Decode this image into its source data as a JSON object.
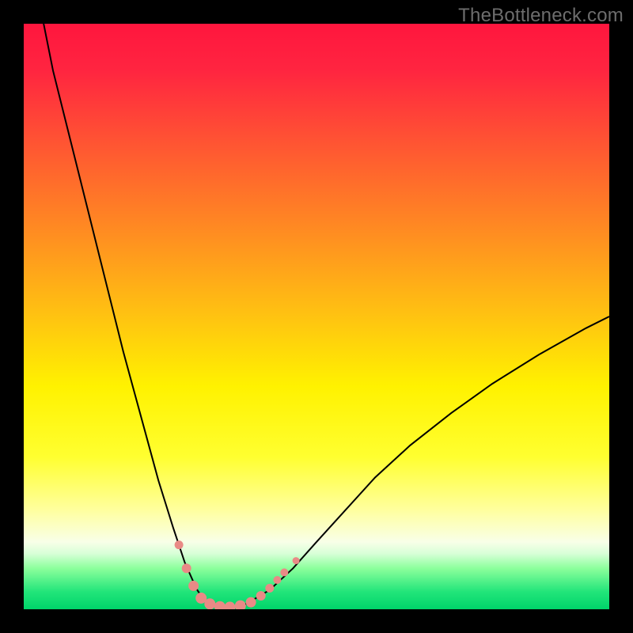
{
  "watermark": {
    "text": "TheBottleneck.com"
  },
  "chart_data": {
    "type": "line",
    "title": "",
    "xlabel": "",
    "ylabel": "",
    "xlim": [
      0,
      100
    ],
    "ylim": [
      0,
      100
    ],
    "background": {
      "gradient_stops": [
        {
          "offset": 0.0,
          "color": "#ff163e"
        },
        {
          "offset": 0.08,
          "color": "#ff2540"
        },
        {
          "offset": 0.2,
          "color": "#ff5333"
        },
        {
          "offset": 0.35,
          "color": "#ff8a22"
        },
        {
          "offset": 0.5,
          "color": "#ffc311"
        },
        {
          "offset": 0.62,
          "color": "#fff200"
        },
        {
          "offset": 0.74,
          "color": "#ffff30"
        },
        {
          "offset": 0.83,
          "color": "#ffff9e"
        },
        {
          "offset": 0.885,
          "color": "#f8ffe8"
        },
        {
          "offset": 0.905,
          "color": "#d7ffd7"
        },
        {
          "offset": 0.93,
          "color": "#8cff9c"
        },
        {
          "offset": 0.97,
          "color": "#22e57a"
        },
        {
          "offset": 1.0,
          "color": "#00d46a"
        }
      ]
    },
    "series": [
      {
        "name": "bottleneck-curve",
        "color": "#000000",
        "stroke_width": 2,
        "x": [
          3,
          5,
          8,
          11,
          14,
          17,
          20,
          23,
          25.5,
          27.5,
          29.5,
          31,
          33,
          35,
          38,
          42,
          46,
          50,
          55,
          60,
          66,
          73,
          80,
          88,
          96,
          100
        ],
        "y": [
          102,
          92,
          80,
          68,
          56,
          44,
          33,
          22,
          14,
          8,
          3.5,
          1.2,
          0.4,
          0.3,
          0.9,
          3.3,
          7,
          11.5,
          17,
          22.5,
          28,
          33.5,
          38.5,
          43.5,
          48,
          50
        ]
      }
    ],
    "markers": [
      {
        "name": "highlight-dots",
        "color": "#e98a86",
        "radius_sequence": [
          5.5,
          6,
          6.5,
          7,
          7,
          7,
          7,
          7,
          6.5,
          6,
          5.5,
          5,
          5,
          4.5
        ],
        "points": [
          {
            "x": 26.5,
            "y": 11.0
          },
          {
            "x": 27.8,
            "y": 7.0
          },
          {
            "x": 29.0,
            "y": 4.0
          },
          {
            "x": 30.3,
            "y": 1.9
          },
          {
            "x": 31.8,
            "y": 0.9
          },
          {
            "x": 33.5,
            "y": 0.45
          },
          {
            "x": 35.2,
            "y": 0.35
          },
          {
            "x": 37.0,
            "y": 0.6
          },
          {
            "x": 38.8,
            "y": 1.2
          },
          {
            "x": 40.5,
            "y": 2.3
          },
          {
            "x": 42.0,
            "y": 3.6
          },
          {
            "x": 43.3,
            "y": 5.0
          },
          {
            "x": 44.5,
            "y": 6.3
          },
          {
            "x": 46.5,
            "y": 8.3
          }
        ]
      }
    ]
  }
}
